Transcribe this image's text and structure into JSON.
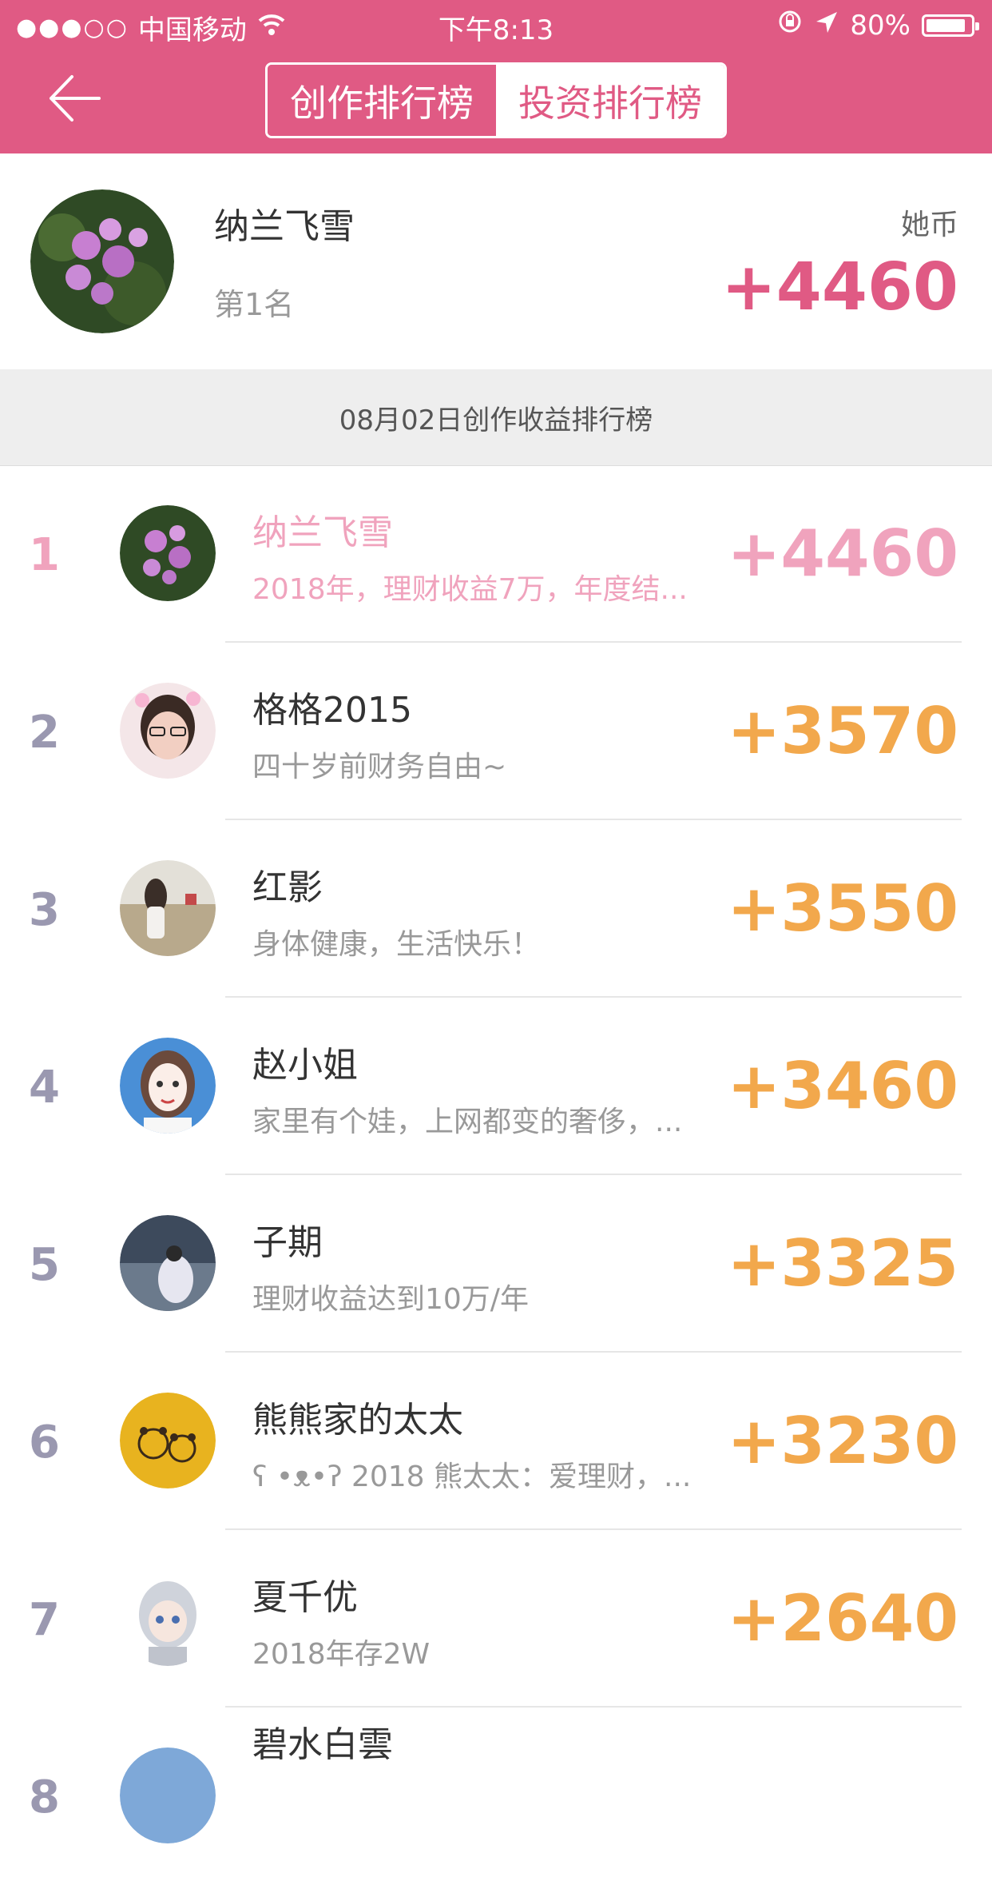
{
  "status_bar": {
    "signal": "●●●○○",
    "carrier": "中国移动",
    "time": "下午8:13",
    "battery": "80%"
  },
  "header": {
    "tabs": [
      {
        "label": "创作排行榜",
        "active": true
      },
      {
        "label": "投资排行榜",
        "active": false
      }
    ]
  },
  "me": {
    "name": "纳兰飞雪",
    "rank": "第1名",
    "unit": "她币",
    "score": "+4460"
  },
  "banner": "08月02日创作收益排行榜",
  "list": [
    {
      "rank": "1",
      "name": "纳兰飞雪",
      "desc": "2018年，理财收益7万，年度结...",
      "score": "+4460"
    },
    {
      "rank": "2",
      "name": "格格2015",
      "desc": "四十岁前财务自由~",
      "score": "+3570"
    },
    {
      "rank": "3",
      "name": "红影",
      "desc": "身体健康，生活快乐！",
      "score": "+3550"
    },
    {
      "rank": "4",
      "name": "赵小姐",
      "desc": "家里有个娃，上网都变的奢侈，...",
      "score": "+3460"
    },
    {
      "rank": "5",
      "name": "子期",
      "desc": "理财收益达到10万/年",
      "score": "+3325"
    },
    {
      "rank": "6",
      "name": "熊熊家的太太",
      "desc": "ʕ •ᴥ•ʔ 2018 熊太太：爱理财，...",
      "score": "+3230"
    },
    {
      "rank": "7",
      "name": "夏千优",
      "desc": "2018年存2W",
      "score": "+2640"
    },
    {
      "rank": "8",
      "name": "碧水白雲",
      "desc": "",
      "score": ""
    }
  ],
  "colors": {
    "accent": "#e05a84",
    "score": "#f2a84c",
    "first_row": "#f0a3bd"
  }
}
